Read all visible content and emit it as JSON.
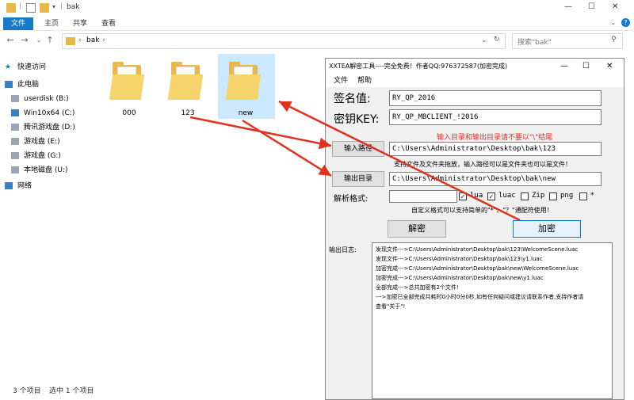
{
  "explorer": {
    "title": "bak",
    "window_controls": {
      "minimize": "—",
      "maximize": "☐",
      "close": "✕"
    },
    "ribbon": {
      "file": "文件",
      "home": "主页",
      "share": "共享",
      "view": "查看"
    },
    "breadcrumb": {
      "folder": "bak",
      "sep1": "›",
      "sep2": "›"
    },
    "search_placeholder": "搜索\"bak\"",
    "sidebar": [
      {
        "label": "快速访问"
      },
      {
        "label": "此电脑"
      },
      {
        "label": "userdisk (B:)"
      },
      {
        "label": "Win10x64 (C:)"
      },
      {
        "label": "腾讯游戏盘 (D:)"
      },
      {
        "label": "游戏盘 (E:)"
      },
      {
        "label": "游戏盘 (G:)"
      },
      {
        "label": "本地磁盘 (U:)"
      },
      {
        "label": "网络"
      }
    ],
    "folders": [
      {
        "name": "000"
      },
      {
        "name": "123"
      },
      {
        "name": "new"
      }
    ],
    "status": {
      "count": "3 个项目",
      "selected": "选中 1 个项目"
    }
  },
  "dialog": {
    "title": "XXTEA解密工具----完全免费！作者QQ:976372587(加密完成)",
    "menu": {
      "file": "文件",
      "help": "帮助"
    },
    "sign_label": "签名值:",
    "sign_value": "RY_QP_2016",
    "key_label": "密钥KEY:",
    "key_value": "RY_QP_MBCLIENT_!2016",
    "warning": "输入目录和输出目录请不要以\"\\\"结尾",
    "input_button": "输入路径",
    "input_path": "C:\\Users\\Administrator\\Desktop\\bak\\123",
    "drag_hint": "支持文件及文件夹拖放，输入路径可以是文件夹也可以是文件！",
    "output_button": "输出目录",
    "output_path": "C:\\Users\\Administrator\\Desktop\\bak\\new",
    "format_label": "解析格式:",
    "formats": [
      {
        "label": "lua",
        "checked": true
      },
      {
        "label": "luac",
        "checked": true
      },
      {
        "label": "Zip",
        "checked": false
      },
      {
        "label": "png",
        "checked": false
      },
      {
        "label": "*",
        "checked": false
      }
    ],
    "custom_hint": "自定义格式可以支持简单的\"*\"、\"？\"通配符使用！",
    "decrypt_button": "解密",
    "encrypt_button": "加密",
    "log_label": "输出日志:",
    "log_lines": [
      "发现文件--->C:\\Users\\Administrator\\Desktop\\bak\\123\\WelcomeScene.luac",
      "发现文件--->C:\\Users\\Administrator\\Desktop\\bak\\123\\y1.luac",
      "加密完成--->C:\\Users\\Administrator\\Desktop\\bak\\new\\WelcomeScene.luac",
      "加密完成--->C:\\Users\\Administrator\\Desktop\\bak\\new\\y1.luac",
      "全部完成--->总共加密有2个文件!",
      "--->加密已全部完成共耗时0小时0分0秒,如有任何疑问或建议请联系作者,支持作者请",
      "查看\"关于\"!"
    ]
  },
  "colors": {
    "accent": "#1979ca",
    "folder": "#e8b84a",
    "arrow": "#e0301e",
    "warning": "#e0301e"
  }
}
